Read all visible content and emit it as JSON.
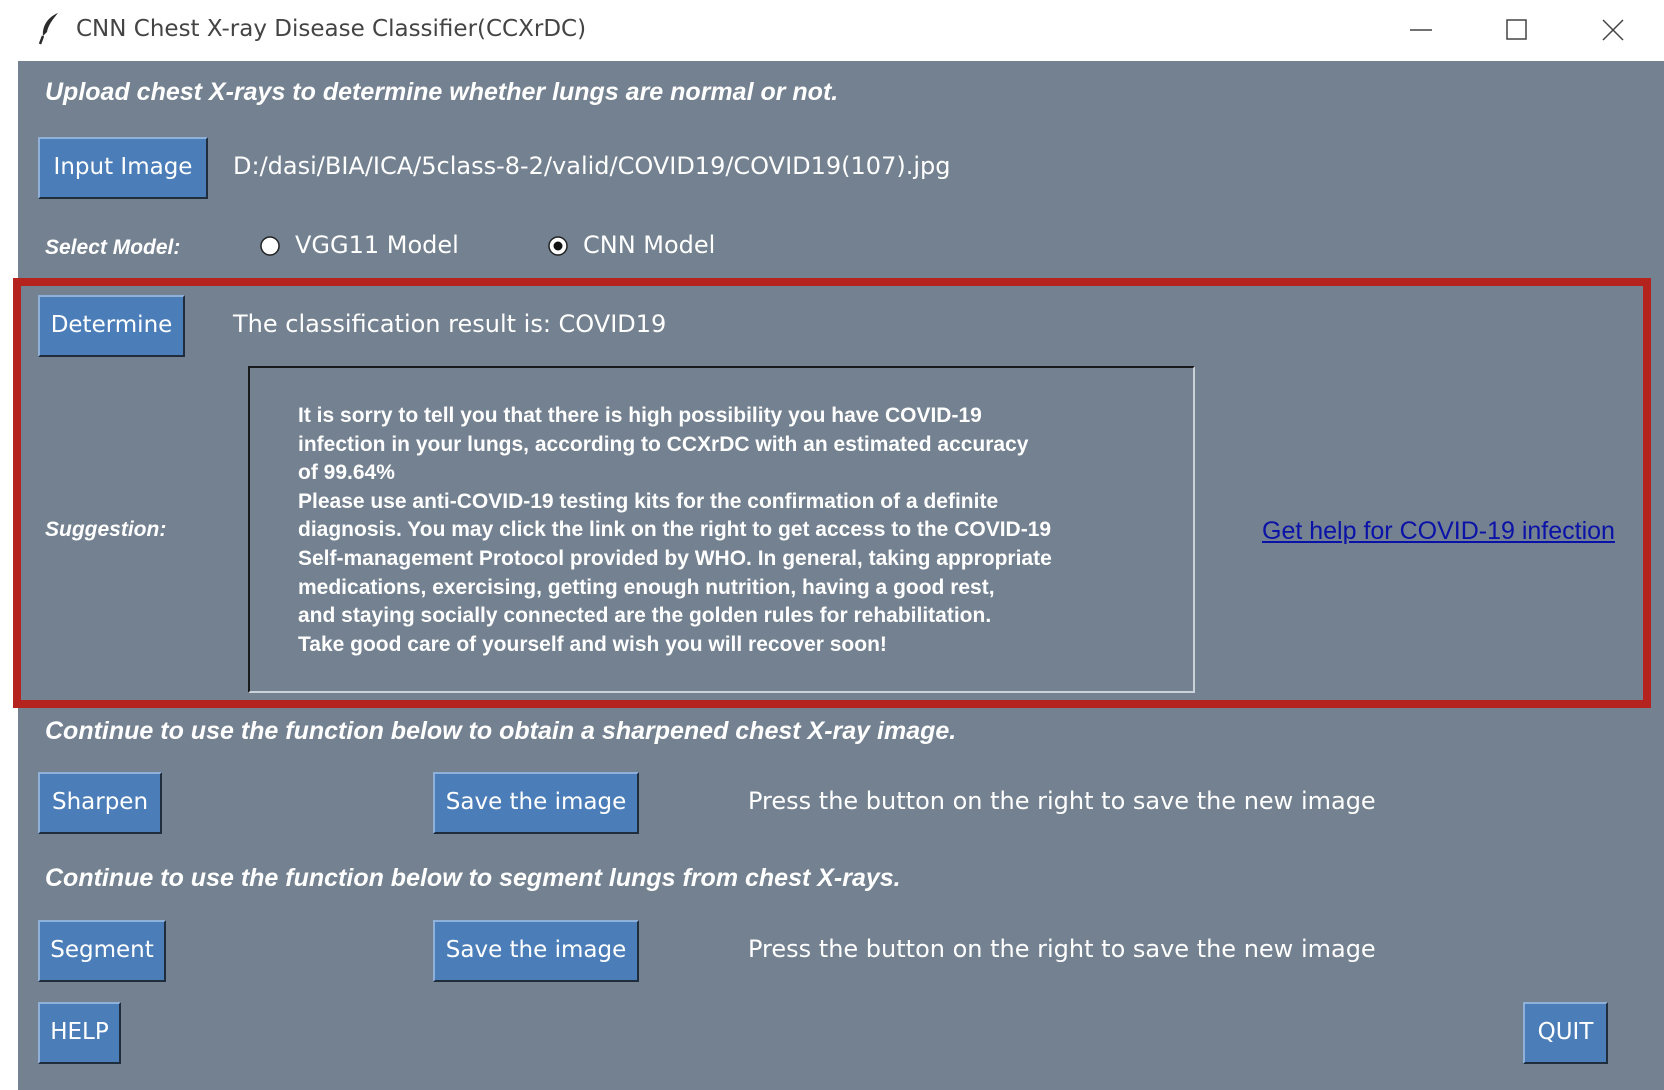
{
  "window": {
    "title": "CNN Chest X-ray Disease Classifier(CCXrDC)",
    "controls": [
      "minimize-icon",
      "maximize-icon",
      "close-icon"
    ],
    "app_icon": "feather-icon"
  },
  "colors": {
    "background": "#738190",
    "button": "#4b7eb9",
    "highlight_border": "#b5231f",
    "link": "#0b12a8"
  },
  "upload": {
    "instruction": "Upload chest X-rays to determine whether lungs are normal or not.",
    "input_button": "Input Image",
    "file_path": "D:/dasi/BIA/ICA/5class-8-2/valid/COVID19/COVID19(107).jpg"
  },
  "model": {
    "label": "Select Model:",
    "options": [
      {
        "label": "VGG11 Model",
        "selected": false
      },
      {
        "label": "CNN Model",
        "selected": true
      }
    ]
  },
  "classification": {
    "determine_button": "Determine",
    "result_text": "The classification result is: COVID19"
  },
  "suggestion": {
    "label": "Suggestion:",
    "lines": [
      "It is sorry to tell you that there is high possibility you have COVID-19",
      "infection in your lungs, according to CCXrDC with an estimated accuracy",
      "of 99.64%",
      "Please use anti-COVID-19 testing kits for the confirmation of a definite",
      "diagnosis. You may click the link on the right to get access to the COVID-19",
      "Self-management Protocol provided by WHO. In general, taking appropriate",
      "medications, exercising, getting enough nutrition, having a good rest,",
      "and staying socially connected are the golden rules for rehabilitation.",
      "Take good care of yourself and wish you will recover soon!"
    ],
    "help_link": "Get help for COVID-19 infection"
  },
  "sharpen": {
    "instruction": "Continue to use the function below to obtain a sharpened chest X-ray image.",
    "button": "Sharpen",
    "save_button": "Save the image",
    "save_hint": "Press the button on the right to save the new image"
  },
  "segment": {
    "instruction": "Continue to use the function below to segment lungs from chest X-rays.",
    "button": "Segment",
    "save_button": "Save the image",
    "save_hint": "Press the button on the right to save the new image"
  },
  "footer": {
    "help_button": "HELP",
    "quit_button": "QUIT"
  }
}
